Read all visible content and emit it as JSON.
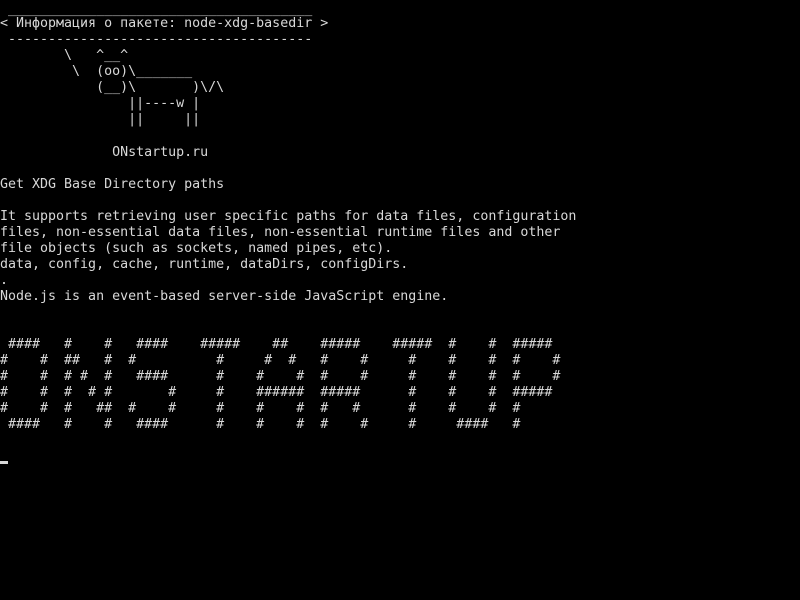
{
  "terminal": {
    "text_color": "#d8d8d8",
    "background_color": "#000000",
    "cowsay": {
      "top_border": " ______________________________________",
      "message": "< Информация о пакете: node-xdg-basedir >",
      "bottom_border": " --------------------------------------",
      "cow": [
        "        \\   ^__^",
        "         \\  (oo)\\_______",
        "            (__)\\       )\\/\\",
        "                ||----w |",
        "                ||     ||"
      ]
    },
    "site": "              ONstartup.ru",
    "summary": "Get XDG Base Directory paths",
    "description": [
      "It supports retrieving user specific paths for data files, configuration",
      "files, non-essential data files, non-essential runtime files and other",
      "file objects (such as sockets, named pipes, etc).",
      "data, config, cache, runtime, dataDirs, configDirs.",
      ".",
      "Node.js is an event-based server-side JavaScript engine."
    ],
    "banner": [
      " ####   #    #   ####    #####    ##    #####    #####  #    #  #####",
      "#    #  ##   #  #          #     #  #   #    #     #    #    #  #    #",
      "#    #  # #  #   ####      #    #    #  #    #     #    #    #  #    #",
      "#    #  #  # #       #     #    ######  #####      #    #    #  #####",
      "#    #  #   ##  #    #     #    #    #  #   #      #    #    #  #",
      " ####   #    #   ####      #    #    #  #    #     #     ####   #"
    ]
  }
}
